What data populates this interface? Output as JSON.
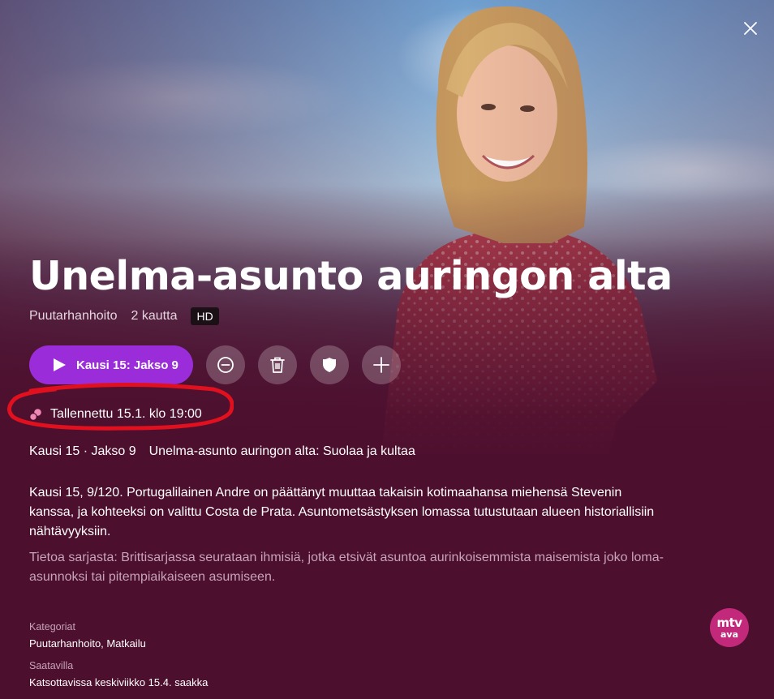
{
  "header": {
    "close_icon": "close-icon"
  },
  "program": {
    "title": "Unelma-asunto auringon alta",
    "genre": "Puutarhanhoito",
    "availability_count": "2 kautta",
    "quality_badge": "HD"
  },
  "actions": {
    "play_label": "Kausi 15: Jakso 9",
    "play_icon": "play-icon",
    "remove_icon": "minus-circle-icon",
    "delete_icon": "trash-icon",
    "protect_icon": "shield-icon",
    "add_icon": "plus-icon"
  },
  "recording": {
    "status_text": "Tallennettu 15.1. klo 19:00",
    "status_icon": "recording-icon",
    "highlight_color": "#e0101e"
  },
  "episode": {
    "season_episode": "Kausi 15 · Jakso 9",
    "episode_title": "Unelma-asunto auringon alta: Suolaa ja kultaa",
    "description": "Kausi 15, 9/120. Portugalilainen Andre on päättänyt muuttaa takaisin kotimaahansa miehensä Stevenin kanssa, ja kohteeksi on valittu Costa de Prata. Asuntometsästyksen lomassa tutustutaan alueen historiallisiin nähtävyyksiin.",
    "series_info": "Tietoa sarjasta: Brittisarjassa seurataan ihmisiä, jotka etsivät asuntoa aurinkoisemmista maisemista joko loma-asunnoksi tai pitempiaikaiseen asumiseen."
  },
  "details": {
    "categories_label": "Kategoriat",
    "categories_value": "Puutarhanhoito, Matkailu",
    "available_label": "Saatavilla",
    "available_value": "Katsottavissa keskiviikko 15.4. saakka"
  },
  "channel": {
    "logo_line1": "mtv",
    "logo_line2": "ava"
  },
  "colors": {
    "background": "#4d0f2e",
    "accent_purple": "#9a2dd9",
    "channel_pink": "#c2297a",
    "muted_text": "#c7a4b8"
  }
}
